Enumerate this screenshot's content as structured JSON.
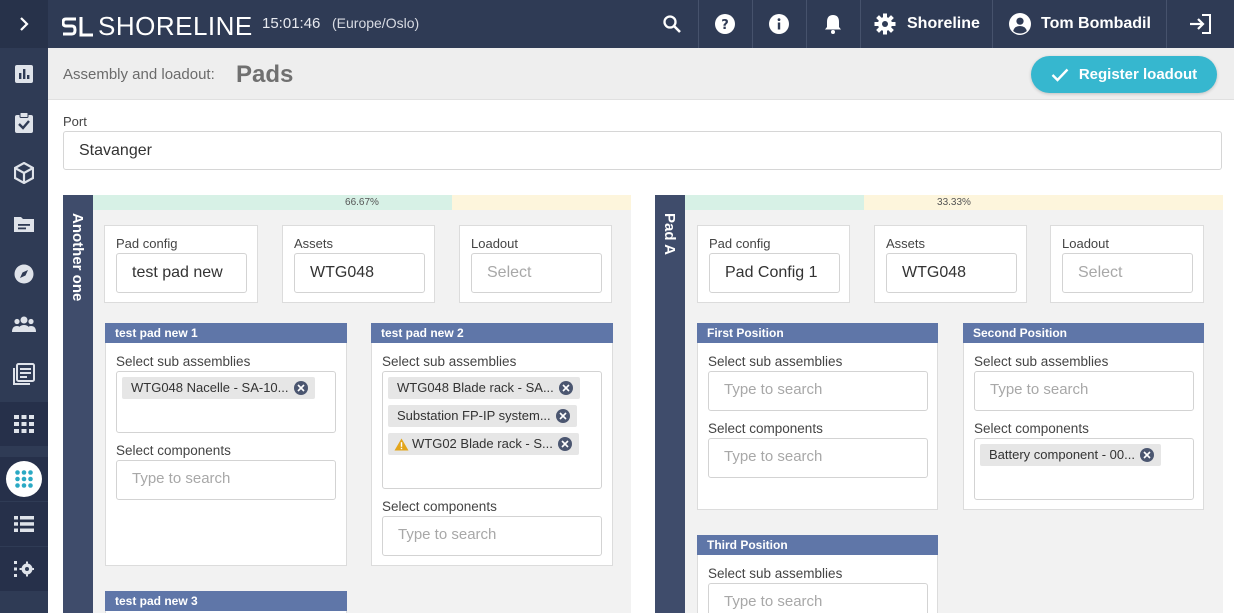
{
  "topbar": {
    "logo_mark": "SL",
    "logo_text": "SHORELINE",
    "time": "15:01:46",
    "timezone": "(Europe/Oslo)",
    "org_name": "Shoreline",
    "user_name": "Tom Bombadil"
  },
  "header": {
    "breadcrumb": "Assembly and loadout:",
    "title": "Pads",
    "register_label": "Register loadout"
  },
  "port": {
    "label": "Port",
    "value": "Stavanger"
  },
  "pads": [
    {
      "name": "Another one",
      "progress_percent": 66.67,
      "progress_label": "66.67%",
      "pad_config_label": "Pad config",
      "pad_config_value": "test pad new",
      "assets_label": "Assets",
      "assets_value": "WTG048",
      "loadout_label": "Loadout",
      "loadout_placeholder": "Select",
      "positions": [
        {
          "title": "test pad new 1",
          "sub_label": "Select sub assemblies",
          "sub_chips": [
            "WTG048 Nacelle - SA-10..."
          ],
          "comp_label": "Select components",
          "comp_placeholder": "Type to search"
        },
        {
          "title": "test pad new 2",
          "sub_label": "Select sub assemblies",
          "sub_chips": [
            "WTG048 Blade rack - SA...",
            "Substation FP-IP system...",
            "WTG02 Blade rack - S..."
          ],
          "comp_label": "Select components",
          "comp_placeholder": "Type to search"
        },
        {
          "title": "test pad new 3"
        }
      ]
    },
    {
      "name": "Pad A",
      "progress_percent": 33.33,
      "progress_label": "33.33%",
      "pad_config_label": "Pad config",
      "pad_config_value": "Pad Config 1",
      "assets_label": "Assets",
      "assets_value": "WTG048",
      "loadout_label": "Loadout",
      "loadout_placeholder": "Select",
      "positions": [
        {
          "title": "First Position",
          "sub_label": "Select sub assemblies",
          "sub_placeholder": "Type to search",
          "comp_label": "Select components",
          "comp_placeholder": "Type to search"
        },
        {
          "title": "Second Position",
          "sub_label": "Select sub assemblies",
          "sub_placeholder": "Type to search",
          "comp_label": "Select components",
          "comp_chips": [
            "Battery component - 00..."
          ]
        },
        {
          "title": "Third Position",
          "sub_label": "Select sub assemblies",
          "sub_placeholder": "Type to search"
        }
      ]
    }
  ],
  "colors": {
    "nav_bg": "#2f3b55",
    "accent": "#36b7cf",
    "position_header": "#5f76a8",
    "pad_side": "#3f4c6b"
  },
  "icons": {
    "rail": [
      "chevron-right-icon",
      "chart-icon",
      "clipboard-check-icon",
      "cube-icon",
      "folder-icon",
      "compass-icon",
      "users-icon",
      "calendar-list-icon",
      "grid-icon",
      "grid-active-icon",
      "list-icon",
      "settings-list-icon"
    ],
    "topbar": [
      "search-icon",
      "help-icon",
      "info-icon",
      "bell-icon",
      "gear-icon",
      "user-circle-icon",
      "logout-icon"
    ]
  }
}
